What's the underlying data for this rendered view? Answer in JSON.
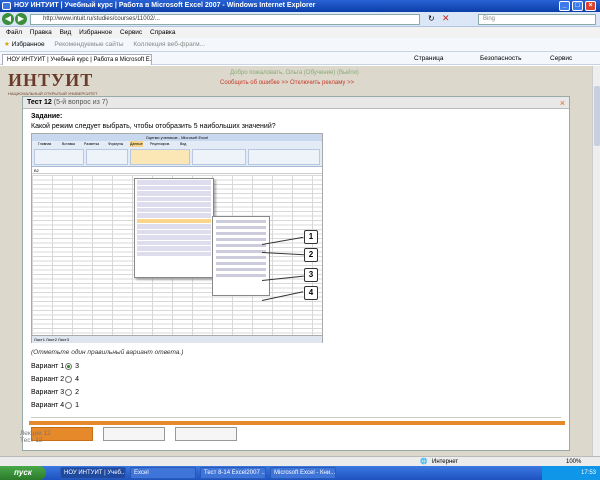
{
  "window": {
    "title": "НОУ ИНТУИТ | Учебный курс | Работа в Microsoft Excel 2007 - Windows Internet Explorer",
    "min": "_",
    "max": "□",
    "close": "×"
  },
  "browser": {
    "address": "http://www.intuit.ru/studies/courses/11002/...",
    "search_placeholder": "Bing",
    "menu": [
      "Файл",
      "Правка",
      "Вид",
      "Избранное",
      "Сервис",
      "Справка"
    ],
    "favorites": {
      "label": "Избранное",
      "items": [
        "Рекомендуемые сайты",
        "Коллекция веб-фрагм..."
      ]
    },
    "tab": "НОУ ИНТУИТ | Учебный курс | Работа в Microsoft E...",
    "tools": [
      "Страница",
      "Безопасность",
      "Сервис"
    ]
  },
  "site": {
    "logo": "ИНТУИТ",
    "logo_sub": "НАЦИОНАЛЬНЫЙ ОТКРЫТЫЙ УНИВЕРСИТЕТ",
    "greeting": "Добро пожаловать, Ольга (Обучение) (Выйти)",
    "promo": "Сообщить об ошибке >>   Отключить рекламу >>"
  },
  "test": {
    "title": "Тест 12",
    "counter": "(5-й вопрос из 7)",
    "close": "×",
    "task_label": "Задание:",
    "question": "Какой режим следует выбрать, чтобы отобразить 5 наибольших значений?",
    "hint": "(Отметьте один правильный вариант ответа.)",
    "options": [
      {
        "label": "Вариант 1",
        "value": "3"
      },
      {
        "label": "Вариант 2",
        "value": "4"
      },
      {
        "label": "Вариант 3",
        "value": "2"
      },
      {
        "label": "Вариант 4",
        "value": "1"
      }
    ],
    "selected_index": 0
  },
  "excel": {
    "title": "Оценки учеников - Microsoft Excel",
    "tabs": [
      "Главная",
      "Вставка",
      "Разметка",
      "Формулы",
      "Данные",
      "Рецензиров.",
      "Вид"
    ],
    "cell": "B2",
    "sheets": "Лист1  Лист2  Лист3",
    "callouts": [
      "1",
      "2",
      "3",
      "4"
    ]
  },
  "below": {
    "a": "Лекция 12",
    "b": "Тест 12"
  },
  "status": {
    "zone": "Интернет",
    "zoom": "100%"
  },
  "taskbar": {
    "start": "пуск",
    "items": [
      "НОУ ИНТУИТ | Учеб...",
      "Excel",
      "Тест 8-14 Excel2007 ...",
      "Microsoft Excel - Кни..."
    ],
    "clock": "17:53"
  }
}
